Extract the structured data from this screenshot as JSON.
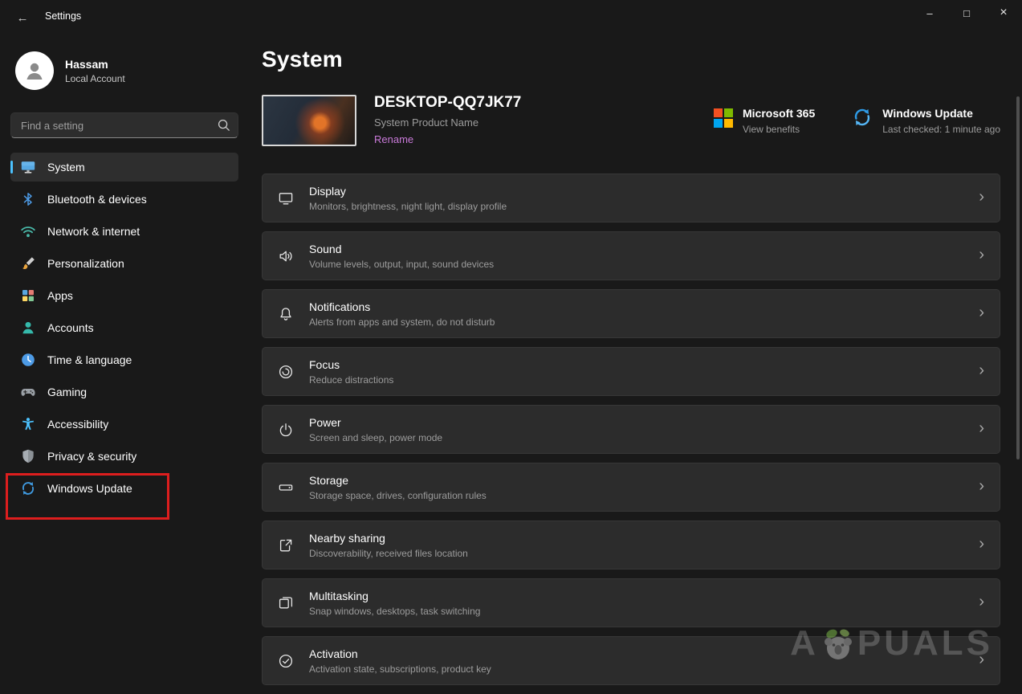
{
  "titlebar": {
    "title": "Settings",
    "back_glyph": "←",
    "minimize_glyph": "–",
    "maximize_glyph": "□",
    "close_glyph": "×"
  },
  "sidebar": {
    "user": {
      "name": "Hassam",
      "type": "Local Account"
    },
    "search": {
      "placeholder": "Find a setting"
    },
    "items": [
      {
        "label": "System",
        "icon": "system-icon",
        "selected": true
      },
      {
        "label": "Bluetooth & devices",
        "icon": "bluetooth-icon"
      },
      {
        "label": "Network & internet",
        "icon": "network-icon"
      },
      {
        "label": "Personalization",
        "icon": "personalization-icon"
      },
      {
        "label": "Apps",
        "icon": "apps-icon"
      },
      {
        "label": "Accounts",
        "icon": "accounts-icon"
      },
      {
        "label": "Time & language",
        "icon": "time-language-icon"
      },
      {
        "label": "Gaming",
        "icon": "gaming-icon"
      },
      {
        "label": "Accessibility",
        "icon": "accessibility-icon"
      },
      {
        "label": "Privacy & security",
        "icon": "privacy-security-icon"
      },
      {
        "label": "Windows Update",
        "icon": "windows-update-icon",
        "annotated": true
      }
    ]
  },
  "main": {
    "page_title": "System",
    "device": {
      "name": "DESKTOP-QQ7JK77",
      "product_name": "System Product Name",
      "rename_label": "Rename"
    },
    "microsoft365": {
      "title": "Microsoft 365",
      "subtitle": "View benefits",
      "icon": "microsoft-365-logo"
    },
    "windows_update": {
      "title": "Windows Update",
      "subtitle": "Last checked: 1 minute ago",
      "icon": "windows-update-icon"
    },
    "rows": [
      {
        "title": "Display",
        "subtitle": "Monitors, brightness, night light, display profile",
        "icon": "display-icon"
      },
      {
        "title": "Sound",
        "subtitle": "Volume levels, output, input, sound devices",
        "icon": "sound-icon"
      },
      {
        "title": "Notifications",
        "subtitle": "Alerts from apps and system, do not disturb",
        "icon": "notifications-icon"
      },
      {
        "title": "Focus",
        "subtitle": "Reduce distractions",
        "icon": "focus-icon"
      },
      {
        "title": "Power",
        "subtitle": "Screen and sleep, power mode",
        "icon": "power-icon"
      },
      {
        "title": "Storage",
        "subtitle": "Storage space, drives, configuration rules",
        "icon": "storage-icon"
      },
      {
        "title": "Nearby sharing",
        "subtitle": "Discoverability, received files location",
        "icon": "nearby-sharing-icon"
      },
      {
        "title": "Multitasking",
        "subtitle": "Snap windows, desktops, task switching",
        "icon": "multitasking-icon"
      },
      {
        "title": "Activation",
        "subtitle": "Activation state, subscriptions, product key",
        "icon": "activation-icon"
      }
    ],
    "chevron_glyph": "›"
  },
  "watermark": {
    "text": "APPUALS",
    "left": "A",
    "right": "PUALS"
  },
  "colors": {
    "accent": "#4cc2ff",
    "rename_link": "#c97ad9",
    "annotation": "#dd1e1e",
    "ms_red": "#f25022",
    "ms_green": "#7fba00",
    "ms_blue": "#00a4ef",
    "ms_yellow": "#ffb900"
  }
}
